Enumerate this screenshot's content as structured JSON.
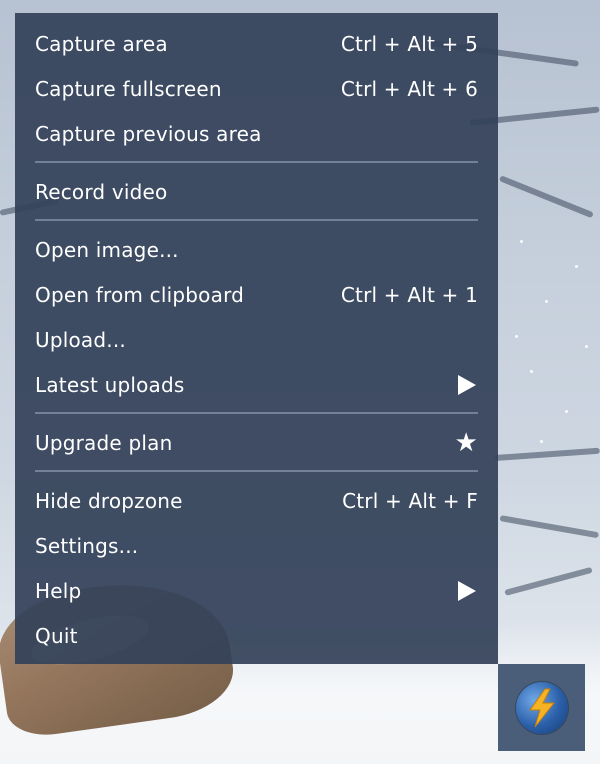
{
  "menu": {
    "items": [
      {
        "label": "Capture area",
        "shortcut": "Ctrl + Alt + 5"
      },
      {
        "label": "Capture fullscreen",
        "shortcut": "Ctrl + Alt + 6"
      },
      {
        "label": "Capture previous area",
        "shortcut": ""
      },
      {
        "label": "Record video",
        "shortcut": ""
      },
      {
        "label": "Open image...",
        "shortcut": ""
      },
      {
        "label": "Open from clipboard",
        "shortcut": "Ctrl + Alt + 1"
      },
      {
        "label": "Upload...",
        "shortcut": ""
      },
      {
        "label": "Latest uploads",
        "icon": "arrow-right-icon"
      },
      {
        "label": "Upgrade plan",
        "icon": "star-icon"
      },
      {
        "label": "Hide dropzone",
        "shortcut": "Ctrl + Alt + F"
      },
      {
        "label": "Settings...",
        "shortcut": ""
      },
      {
        "label": "Help",
        "icon": "arrow-right-icon"
      },
      {
        "label": "Quit",
        "shortcut": ""
      }
    ]
  },
  "tray": {
    "icon": "lightning-app-icon"
  },
  "colors": {
    "menu_background": "#344259",
    "menu_text": "#ffffff",
    "separator": "#96a5b9",
    "tray_background": "#4a5e7a",
    "app_icon_bolt": "#f5b324"
  }
}
